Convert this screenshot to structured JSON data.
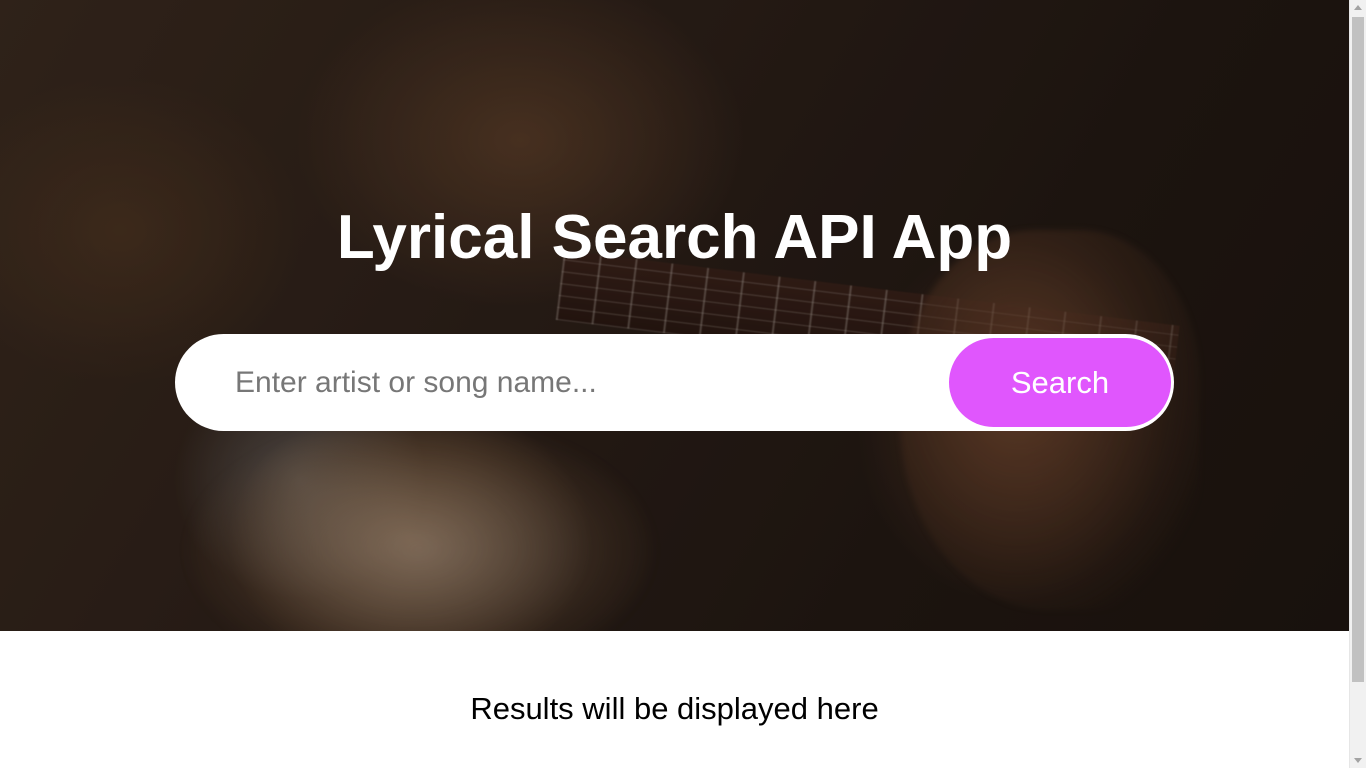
{
  "hero": {
    "title": "Lyrical Search API App"
  },
  "search": {
    "placeholder": "Enter artist or song name...",
    "value": "",
    "button_label": "Search"
  },
  "results": {
    "text": "Results will be displayed here"
  },
  "colors": {
    "accent": "#e056fd",
    "hero_text": "#ffffff",
    "input_background": "#ffffff"
  }
}
